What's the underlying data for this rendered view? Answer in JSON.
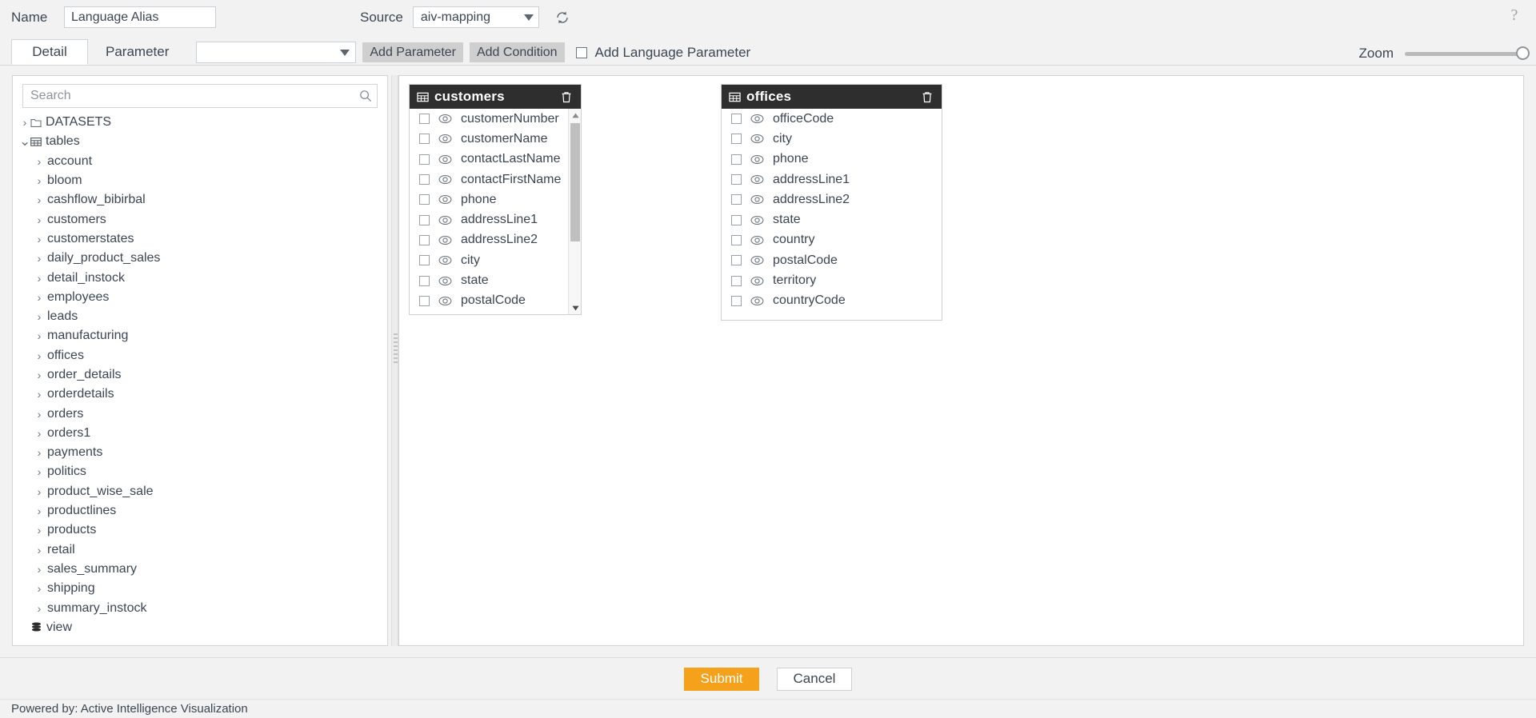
{
  "header": {
    "name_label": "Name",
    "name_value": "Language Alias",
    "source_label": "Source",
    "source_value": "aiv-mapping",
    "refresh_icon": "refresh-icon",
    "help_icon": "help-icon"
  },
  "toolbar": {
    "tabs": [
      {
        "label": "Detail",
        "active": true
      },
      {
        "label": "Parameter",
        "active": false
      }
    ],
    "parameter_select_value": "",
    "add_parameter_label": "Add Parameter",
    "add_condition_label": "Add Condition",
    "add_language_parameter_label": "Add Language Parameter",
    "add_language_parameter_checked": false,
    "zoom_label": "Zoom",
    "zoom_value": 100
  },
  "sidebar": {
    "search_placeholder": "Search",
    "search_value": "",
    "search_icon": "search-icon",
    "tree": [
      {
        "label": "DATASETS",
        "level": 1,
        "expanded": false,
        "icon": "folder-icon"
      },
      {
        "label": "tables",
        "level": 1,
        "expanded": true,
        "icon": "table-icon"
      },
      {
        "label": "account",
        "level": 2,
        "expanded": false
      },
      {
        "label": "bloom",
        "level": 2,
        "expanded": false
      },
      {
        "label": "cashflow_bibirbal",
        "level": 2,
        "expanded": false
      },
      {
        "label": "customers",
        "level": 2,
        "expanded": false
      },
      {
        "label": "customerstates",
        "level": 2,
        "expanded": false
      },
      {
        "label": "daily_product_sales",
        "level": 2,
        "expanded": false
      },
      {
        "label": "detail_instock",
        "level": 2,
        "expanded": false
      },
      {
        "label": "employees",
        "level": 2,
        "expanded": false
      },
      {
        "label": "leads",
        "level": 2,
        "expanded": false
      },
      {
        "label": "manufacturing",
        "level": 2,
        "expanded": false
      },
      {
        "label": "offices",
        "level": 2,
        "expanded": false
      },
      {
        "label": "order_details",
        "level": 2,
        "expanded": false
      },
      {
        "label": "orderdetails",
        "level": 2,
        "expanded": false
      },
      {
        "label": "orders",
        "level": 2,
        "expanded": false
      },
      {
        "label": "orders1",
        "level": 2,
        "expanded": false
      },
      {
        "label": "payments",
        "level": 2,
        "expanded": false
      },
      {
        "label": "politics",
        "level": 2,
        "expanded": false
      },
      {
        "label": "product_wise_sale",
        "level": 2,
        "expanded": false
      },
      {
        "label": "productlines",
        "level": 2,
        "expanded": false
      },
      {
        "label": "products",
        "level": 2,
        "expanded": false
      },
      {
        "label": "retail",
        "level": 2,
        "expanded": false
      },
      {
        "label": "sales_summary",
        "level": 2,
        "expanded": false
      },
      {
        "label": "shipping",
        "level": 2,
        "expanded": false
      },
      {
        "label": "summary_instock",
        "level": 2,
        "expanded": false
      },
      {
        "label": "view",
        "level": 1,
        "expanded": false,
        "icon": "database-icon"
      }
    ]
  },
  "canvas": {
    "cards": [
      {
        "title": "customers",
        "header_icon": "table-icon",
        "delete_icon": "trash-icon",
        "scrollable": true,
        "fields": [
          {
            "name": "customerNumber",
            "checked": false,
            "visibility_icon": "eye-icon"
          },
          {
            "name": "customerName",
            "checked": false,
            "visibility_icon": "eye-icon"
          },
          {
            "name": "contactLastName",
            "checked": false,
            "visibility_icon": "eye-icon"
          },
          {
            "name": "contactFirstName",
            "checked": false,
            "visibility_icon": "eye-icon"
          },
          {
            "name": "phone",
            "checked": false,
            "visibility_icon": "eye-icon"
          },
          {
            "name": "addressLine1",
            "checked": false,
            "visibility_icon": "eye-icon"
          },
          {
            "name": "addressLine2",
            "checked": false,
            "visibility_icon": "eye-icon"
          },
          {
            "name": "city",
            "checked": false,
            "visibility_icon": "eye-icon"
          },
          {
            "name": "state",
            "checked": false,
            "visibility_icon": "eye-icon"
          },
          {
            "name": "postalCode",
            "checked": false,
            "visibility_icon": "eye-icon"
          }
        ]
      },
      {
        "title": "offices",
        "header_icon": "table-icon",
        "delete_icon": "trash-icon",
        "scrollable": false,
        "fields": [
          {
            "name": "officeCode",
            "checked": false,
            "visibility_icon": "eye-icon"
          },
          {
            "name": "city",
            "checked": false,
            "visibility_icon": "eye-icon"
          },
          {
            "name": "phone",
            "checked": false,
            "visibility_icon": "eye-icon"
          },
          {
            "name": "addressLine1",
            "checked": false,
            "visibility_icon": "eye-icon"
          },
          {
            "name": "addressLine2",
            "checked": false,
            "visibility_icon": "eye-icon"
          },
          {
            "name": "state",
            "checked": false,
            "visibility_icon": "eye-icon"
          },
          {
            "name": "country",
            "checked": false,
            "visibility_icon": "eye-icon"
          },
          {
            "name": "postalCode",
            "checked": false,
            "visibility_icon": "eye-icon"
          },
          {
            "name": "territory",
            "checked": false,
            "visibility_icon": "eye-icon"
          },
          {
            "name": "countryCode",
            "checked": false,
            "visibility_icon": "eye-icon"
          }
        ]
      }
    ]
  },
  "footer": {
    "submit_label": "Submit",
    "cancel_label": "Cancel",
    "submit_color": "#f6a11b"
  },
  "statusbar": {
    "powered_by": "Powered by: Active Intelligence Visualization"
  }
}
